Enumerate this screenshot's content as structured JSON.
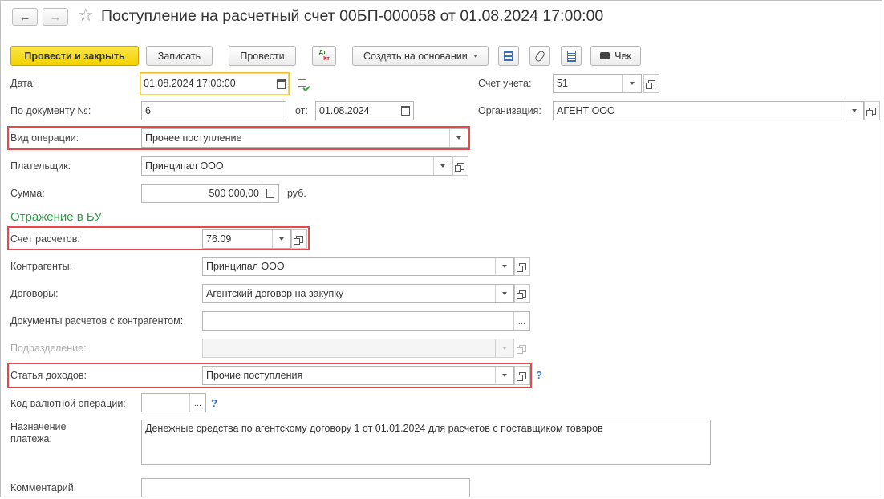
{
  "header": {
    "title": "Поступление на расчетный счет 00БП-000058 от 01.08.2024 17:00:00",
    "back_icon": "←",
    "forward_icon": "→",
    "star_icon": "☆"
  },
  "toolbar": {
    "post_close": "Провести и закрыть",
    "save": "Записать",
    "post": "Провести",
    "dtkt_dt": "Дт",
    "dtkt_kt": "Кт",
    "create_based": "Создать на основании",
    "check": "Чек"
  },
  "form": {
    "date_label": "Дата:",
    "date_value": "01.08.2024 17:00:00",
    "doc_no_label": "По документу №:",
    "doc_no_value": "6",
    "from_label": "от:",
    "from_value": "01.08.2024",
    "account_label": "Счет учета:",
    "account_value": "51",
    "org_label": "Организация:",
    "org_value": "АГЕНТ ООО",
    "op_type_label": "Вид операции:",
    "op_type_value": "Прочее поступление",
    "payer_label": "Плательщик:",
    "payer_value": "Принципал ООО",
    "amount_label": "Сумма:",
    "amount_value": "500 000,00",
    "currency": "руб.",
    "section_title": "Отражение в БУ",
    "settle_acc_label": "Счет расчетов:",
    "settle_acc_value": "76.09",
    "contractors_label": "Контрагенты:",
    "contractors_value": "Принципал ООО",
    "contracts_label": "Договоры:",
    "contracts_value": "Агентский договор на закупку",
    "settle_docs_label": "Документы расчетов с контрагентом:",
    "settle_docs_value": "",
    "division_label": "Подразделение:",
    "income_item_label": "Статья доходов:",
    "income_item_value": "Прочие поступления",
    "currency_op_label": "Код валютной операции:",
    "help": "?",
    "purpose_label_1": "Назначение",
    "purpose_label_2": "платежа:",
    "purpose_value": "Денежные средства по агентскому договору 1 от 01.01.2024 для расчетов с поставщиком товаров",
    "comment_label": "Комментарий:"
  },
  "colors": {
    "primary_button": "#f2d200",
    "highlight": "#e5484d",
    "section": "#2e9b4b",
    "help": "#3a7bd5"
  }
}
